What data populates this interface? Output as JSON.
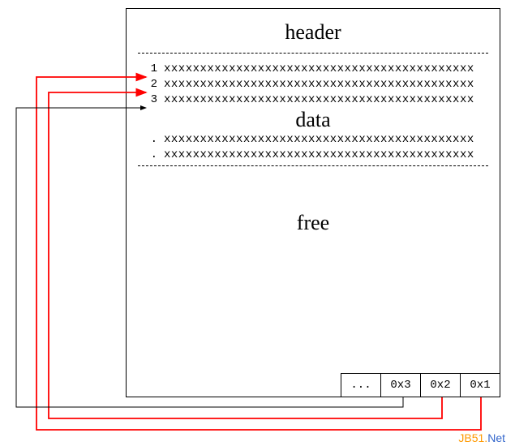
{
  "sections": {
    "header_label": "header",
    "data_label": "data",
    "free_label": "free"
  },
  "rows": [
    {
      "num": "1",
      "content": "xxxxxxxxxxxxxxxxxxxxxxxxxxxxxxxxxxxxxxxxxxx"
    },
    {
      "num": "2",
      "content": "xxxxxxxxxxxxxxxxxxxxxxxxxxxxxxxxxxxxxxxxxxx"
    },
    {
      "num": "3",
      "content": "xxxxxxxxxxxxxxxxxxxxxxxxxxxxxxxxxxxxxxxxxxx"
    },
    {
      "num": ".",
      "content": "xxxxxxxxxxxxxxxxxxxxxxxxxxxxxxxxxxxxxxxxxxx"
    },
    {
      "num": ".",
      "content": "xxxxxxxxxxxxxxxxxxxxxxxxxxxxxxxxxxxxxxxxxxx"
    }
  ],
  "offset_cells": {
    "c0": "...",
    "c1": "0x3",
    "c2": "0x2",
    "c3": "0x1"
  },
  "watermark": {
    "part1": "JB51.",
    "part2": "Net"
  },
  "arrow_colors": {
    "red": "#ff0000",
    "black": "#000000"
  }
}
